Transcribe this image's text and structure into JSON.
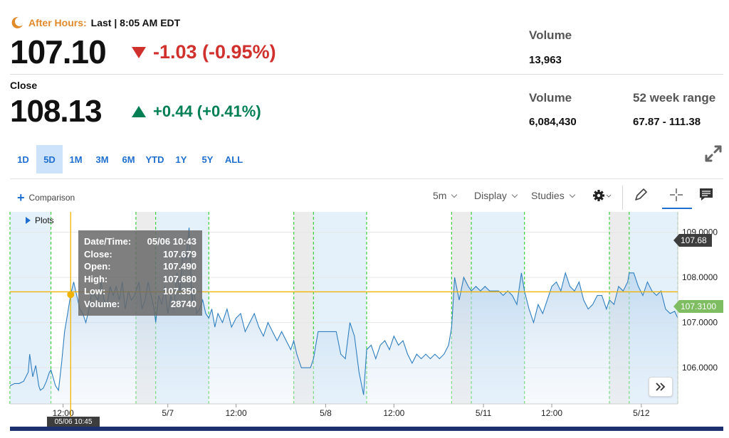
{
  "quote": {
    "after_hours_label": "After Hours:",
    "after_hours_rest": "Last | 8:05 AM EDT",
    "ah_price": "107.10",
    "ah_change": "-1.03 (-0.95%)",
    "close_label": "Close",
    "close_price": "108.13",
    "close_change": "+0.44 (+0.41%)"
  },
  "stats": {
    "ah_volume_label": "Volume",
    "ah_volume": "13,963",
    "volume_label": "Volume",
    "volume": "6,084,430",
    "range_label": "52 week range",
    "range": "67.87 - 111.38"
  },
  "tabs": [
    {
      "label": "1D",
      "active": false
    },
    {
      "label": "5D",
      "active": true
    },
    {
      "label": "1M",
      "active": false
    },
    {
      "label": "3M",
      "active": false
    },
    {
      "label": "6M",
      "active": false
    },
    {
      "label": "YTD",
      "active": false
    },
    {
      "label": "1Y",
      "active": false
    },
    {
      "label": "5Y",
      "active": false
    },
    {
      "label": "ALL",
      "active": false
    }
  ],
  "toolbar": {
    "comparison": "Comparison",
    "interval": "5m",
    "display": "Display",
    "studies": "Studies",
    "plots": "Plots"
  },
  "icons": {
    "moon": "moon-icon",
    "expand": "expand-icon",
    "gear": "gear-icon",
    "draw": "pencil-icon",
    "crosshair": "crosshair-icon",
    "comment": "comment-icon",
    "more": "double-chevron-right-icon"
  },
  "colors": {
    "accent": "#1f6fd1",
    "down": "#d0312d",
    "up": "#007f55",
    "after_hours": "#e08a2c",
    "line": "#2f7fbf",
    "crosshair": "#f0b400",
    "session_green": "#3dd13d"
  },
  "tooltip": {
    "rows": [
      {
        "label": "Date/Time:",
        "value": "05/06 10:43"
      },
      {
        "label": "Close:",
        "value": "107.679"
      },
      {
        "label": "Open:",
        "value": "107.490"
      },
      {
        "label": "High:",
        "value": "107.680"
      },
      {
        "label": "Low:",
        "value": "107.350"
      },
      {
        "label": "Volume:",
        "value": "28740"
      }
    ]
  },
  "badges": {
    "crosshair_price": "107.68",
    "last_price": "107.3100",
    "cursor_date": "05/06 10:45"
  },
  "chart_data": {
    "type": "line",
    "title": "",
    "xlabel": "",
    "ylabel": "",
    "y_ticks": [
      "109.0000",
      "108.0000",
      "107.0000",
      "106.0000"
    ],
    "x_ticks": [
      {
        "label": "12:00",
        "x": 35
      },
      {
        "label": "5/7",
        "x": 104
      },
      {
        "label": "12:00",
        "x": 149
      },
      {
        "label": "5/8",
        "x": 208
      },
      {
        "label": "12:00",
        "x": 253
      },
      {
        "label": "5/11",
        "x": 312
      },
      {
        "label": "12:00",
        "x": 357
      },
      {
        "label": "5/12",
        "x": 416
      }
    ],
    "x_range": [
      0,
      440
    ],
    "ylim": [
      105.2,
      109.45
    ],
    "sessions": [
      {
        "start": 0,
        "end": 27,
        "shade": "blue"
      },
      {
        "start": 83,
        "end": 96,
        "shade": "gray"
      },
      {
        "start": 96,
        "end": 131,
        "shade": "blue"
      },
      {
        "start": 187,
        "end": 200,
        "shade": "gray"
      },
      {
        "start": 200,
        "end": 235,
        "shade": "blue"
      },
      {
        "start": 291,
        "end": 304,
        "shade": "gray"
      },
      {
        "start": 304,
        "end": 339,
        "shade": "blue"
      },
      {
        "start": 395,
        "end": 408,
        "shade": "gray"
      },
      {
        "start": 408,
        "end": 440,
        "shade": "blue"
      }
    ],
    "session_lines": [
      0,
      27,
      83,
      96,
      131,
      187,
      200,
      235,
      291,
      304,
      339,
      395,
      408,
      440
    ],
    "crosshair": {
      "x": 40,
      "y": 107.68
    },
    "marker": {
      "x": 40,
      "y": 107.62
    },
    "last_price": 107.31,
    "x": [
      0,
      3,
      6,
      9,
      12,
      13,
      15,
      17,
      19,
      20,
      22,
      24,
      26,
      27,
      30,
      32,
      34,
      36,
      38,
      40,
      42,
      44,
      46,
      48,
      50,
      52,
      54,
      56,
      58,
      60,
      62,
      64,
      66,
      68,
      70,
      72,
      74,
      76,
      78,
      80,
      82,
      83,
      85,
      87,
      89,
      91,
      93,
      95,
      96,
      98,
      100,
      102,
      104,
      106,
      108,
      110,
      112,
      114,
      116,
      118,
      120,
      121,
      123,
      125,
      127,
      129,
      131,
      133,
      135,
      137,
      140,
      143,
      146,
      149,
      152,
      155,
      158,
      161,
      164,
      167,
      170,
      173,
      176,
      179,
      182,
      185,
      187,
      189,
      192,
      195,
      198,
      200,
      203,
      206,
      209,
      212,
      215,
      218,
      221,
      224,
      227,
      230,
      233,
      235,
      238,
      241,
      244,
      247,
      250,
      253,
      256,
      259,
      262,
      265,
      268,
      271,
      274,
      277,
      280,
      283,
      286,
      289,
      291,
      293,
      296,
      299,
      302,
      304,
      307,
      310,
      313,
      316,
      319,
      322,
      325,
      328,
      331,
      334,
      337,
      339,
      342,
      345,
      348,
      351,
      354,
      357,
      360,
      363,
      366,
      369,
      372,
      375,
      378,
      381,
      384,
      387,
      390,
      393,
      395,
      398,
      401,
      404,
      407,
      408,
      411,
      414,
      417,
      420,
      423,
      426,
      429,
      432,
      435,
      438,
      440
    ],
    "y": [
      105.6,
      105.65,
      105.65,
      105.7,
      105.9,
      106.3,
      105.8,
      106.05,
      105.6,
      105.5,
      105.55,
      105.7,
      105.9,
      105.95,
      105.6,
      105.5,
      106.1,
      106.8,
      107.2,
      107.62,
      107.9,
      107.6,
      107.3,
      107.2,
      107.0,
      107.3,
      107.7,
      107.6,
      107.5,
      107.9,
      107.5,
      107.4,
      107.8,
      107.6,
      107.8,
      107.5,
      107.9,
      107.3,
      107.7,
      107.5,
      107.6,
      107.7,
      107.9,
      107.3,
      107.5,
      107.9,
      107.6,
      107.3,
      107.0,
      107.6,
      107.4,
      107.8,
      107.2,
      107.6,
      107.3,
      108.1,
      107.7,
      108.6,
      108.4,
      109.1,
      107.4,
      107.8,
      107.2,
      107.3,
      107.5,
      107.2,
      107.1,
      107.3,
      106.9,
      107.2,
      107.0,
      107.3,
      106.9,
      107.1,
      107.2,
      106.8,
      107.0,
      107.2,
      106.9,
      106.7,
      107.0,
      106.8,
      106.6,
      106.8,
      106.6,
      106.4,
      106.6,
      106.3,
      106.0,
      106.0,
      106.0,
      106.2,
      106.8,
      106.8,
      106.8,
      106.8,
      106.8,
      106.3,
      106.2,
      107.0,
      106.7,
      105.9,
      105.4,
      106.4,
      106.5,
      106.2,
      106.5,
      106.6,
      106.4,
      106.7,
      106.5,
      106.6,
      106.3,
      106.1,
      106.3,
      106.2,
      106.3,
      106.2,
      106.3,
      106.2,
      106.3,
      106.5,
      106.9,
      108.0,
      107.5,
      108.0,
      107.8,
      107.7,
      107.8,
      107.7,
      107.8,
      107.7,
      107.7,
      107.7,
      107.6,
      107.7,
      107.6,
      107.4,
      108.1,
      107.7,
      107.3,
      107.0,
      107.4,
      107.2,
      107.5,
      107.8,
      107.9,
      107.7,
      108.1,
      107.8,
      107.7,
      107.9,
      107.5,
      107.3,
      107.4,
      107.6,
      107.6,
      107.3,
      107.5,
      107.4,
      107.8,
      107.7,
      107.9,
      108.1,
      108.1,
      107.8,
      107.6,
      107.9,
      107.7,
      107.6,
      107.7,
      107.3,
      107.2,
      107.25,
      107.1,
      107.25,
      107.3
    ]
  }
}
